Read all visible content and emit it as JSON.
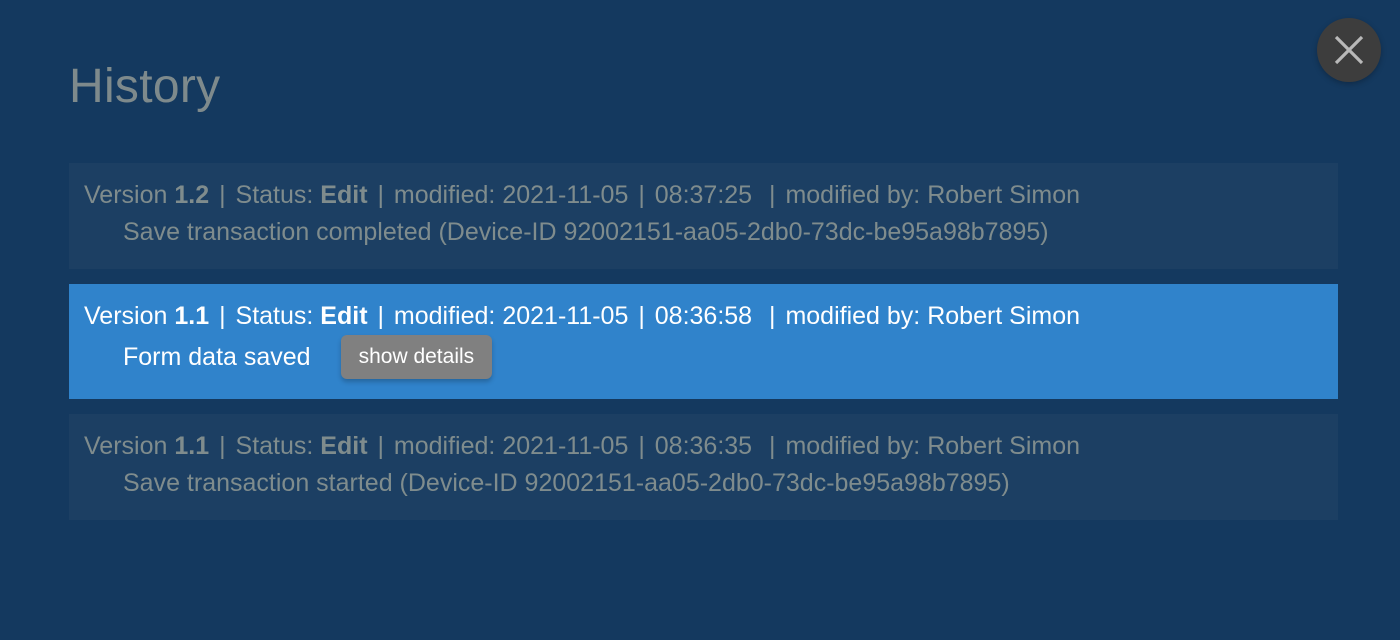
{
  "dialog": {
    "title": "History",
    "close_label": "×",
    "close_icon": "close-x-icon",
    "accent_color": "#3083cb",
    "background_color": "#14395f",
    "row_color": "#1c3f63",
    "muted_text_color": "#7f8c8d"
  },
  "entries": [
    {
      "version_label": "Version",
      "version": "1.2",
      "status_label": "Status:",
      "status": "Edit",
      "modified_label": "modified:",
      "date": "2021-11-05",
      "time": "08:37:25",
      "modified_by_label": "modified by:",
      "user": "Robert Simon",
      "description": "Save transaction completed (Device-ID 92002151-aa05-2db0-73dc-be95a98b7895)",
      "selected": false,
      "has_details_button": false,
      "details_button_label": ""
    },
    {
      "version_label": "Version",
      "version": "1.1",
      "status_label": "Status:",
      "status": "Edit",
      "modified_label": "modified:",
      "date": "2021-11-05",
      "time": "08:36:58",
      "modified_by_label": "modified by:",
      "user": "Robert Simon",
      "description": "Form data saved",
      "selected": true,
      "has_details_button": true,
      "details_button_label": "show details"
    },
    {
      "version_label": "Version",
      "version": "1.1",
      "status_label": "Status:",
      "status": "Edit",
      "modified_label": "modified:",
      "date": "2021-11-05",
      "time": "08:36:35",
      "modified_by_label": "modified by:",
      "user": "Robert Simon",
      "description": "Save transaction started (Device-ID 92002151-aa05-2db0-73dc-be95a98b7895)",
      "selected": false,
      "has_details_button": false,
      "details_button_label": ""
    }
  ],
  "separator": "|"
}
